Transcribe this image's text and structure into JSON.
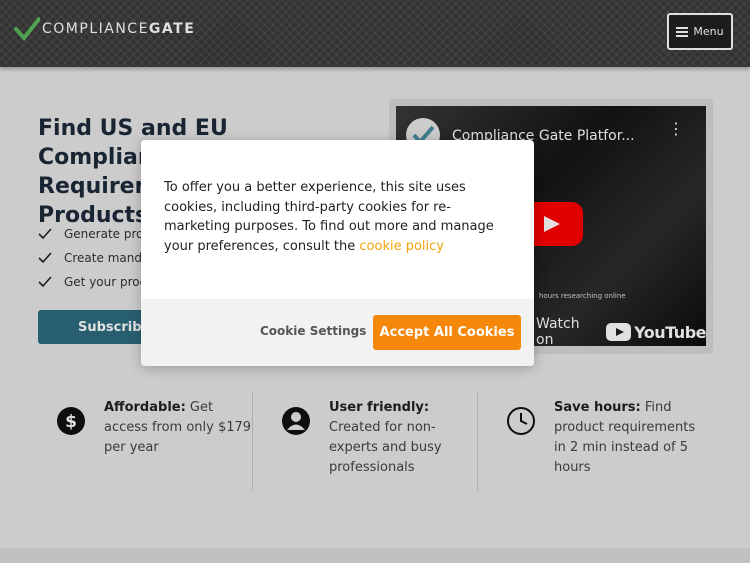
{
  "header": {
    "logo_text_light": "COMPLIANCE",
    "logo_text_bold": "GATE",
    "menu_label": "Menu"
  },
  "hero": {
    "title": "Find US and EU Compliance Requirements for Your Products",
    "checklist": [
      "Generate product requirement reports",
      "Create mandatory compliance checklists",
      "Get your product compliant"
    ],
    "subscribe_label": "Subscribe"
  },
  "video": {
    "title": "Compliance Gate Platfor...",
    "overlay_small": "hours researching online",
    "watch_on": "Watch on",
    "youtube_word": "YouTube"
  },
  "features": [
    {
      "icon": "dollar-icon",
      "bold": "Affordable:",
      "text": " Get access from only $179 per year"
    },
    {
      "icon": "user-icon",
      "bold": "User friendly:",
      "text": " Created for non-experts and busy professionals"
    },
    {
      "icon": "clock-icon",
      "bold": "Save hours:",
      "text": " Find product requirements in 2 min instead of 5 hours"
    }
  ],
  "cookie_modal": {
    "message": "To offer you a better experience, this site uses cookies, including third-party cookies for re-marketing purposes. To find out more and manage your preferences, consult the ",
    "policy_link": "cookie policy",
    "settings_label": "Cookie Settings",
    "accept_label": "Accept All Cookies"
  },
  "colors": {
    "accent_orange": "#f5870a",
    "link_orange": "#f5a20c",
    "subscribe_blue": "#2e6d80",
    "check_green": "#4caf50"
  }
}
